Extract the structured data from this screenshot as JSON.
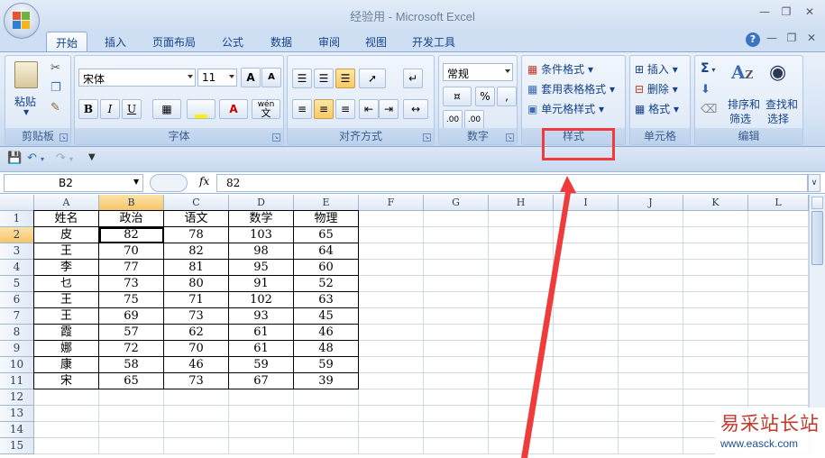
{
  "window": {
    "title": "经验用 - Microsoft Excel"
  },
  "tabs": [
    "开始",
    "插入",
    "页面布局",
    "公式",
    "数据",
    "审阅",
    "视图",
    "开发工具"
  ],
  "ribbon": {
    "clipboard": {
      "paste": "粘贴",
      "label": "剪贴板"
    },
    "font": {
      "name": "宋体",
      "size": "11",
      "label": "字体",
      "bold": "B",
      "italic": "I",
      "underline": "U",
      "grow": "A",
      "shrink": "A",
      "wen": "wén",
      "wen2": "文"
    },
    "alignment": {
      "label": "对齐方式"
    },
    "number": {
      "format": "常规",
      "percent": "%",
      "comma": ",",
      "label": "数字",
      "inc": ".00",
      "dec": ".00"
    },
    "styles": {
      "conditional": "条件格式",
      "table": "套用表格格式",
      "cell": "单元格样式",
      "label": "样式"
    },
    "cells": {
      "insert": "插入",
      "delete": "删除",
      "format": "格式",
      "label": "单元格"
    },
    "editing": {
      "sum": "Σ",
      "sort1": "排序和",
      "sort2": "筛选",
      "find1": "查找和",
      "find2": "选择",
      "label": "编辑"
    }
  },
  "formula_bar": {
    "name_box": "B2",
    "fx": "fx",
    "value": "82"
  },
  "columns": [
    "A",
    "B",
    "C",
    "D",
    "E",
    "F",
    "G",
    "H",
    "I",
    "J",
    "K",
    "L"
  ],
  "rows": [
    "1",
    "2",
    "3",
    "4",
    "5",
    "6",
    "7",
    "8",
    "9",
    "10",
    "11",
    "12",
    "13",
    "14",
    "15"
  ],
  "table": [
    [
      "姓名",
      "政治",
      "语文",
      "数学",
      "物理"
    ],
    [
      "皮",
      "82",
      "78",
      "103",
      "65"
    ],
    [
      "王",
      "70",
      "82",
      "98",
      "64"
    ],
    [
      "李",
      "77",
      "81",
      "95",
      "60"
    ],
    [
      "乜",
      "73",
      "80",
      "91",
      "52"
    ],
    [
      "王",
      "75",
      "71",
      "102",
      "63"
    ],
    [
      "王",
      "69",
      "73",
      "93",
      "45"
    ],
    [
      "霞",
      "57",
      "62",
      "61",
      "46"
    ],
    [
      "娜",
      "72",
      "70",
      "61",
      "48"
    ],
    [
      "康",
      "58",
      "46",
      "59",
      "59"
    ],
    [
      "宋",
      "65",
      "73",
      "67",
      "39"
    ]
  ],
  "watermark": {
    "brand": "易采站长站",
    "url": "www.easck.com"
  },
  "colors": {
    "highlight": "#ef3b3b",
    "ribbon": "#dbe7f6"
  }
}
